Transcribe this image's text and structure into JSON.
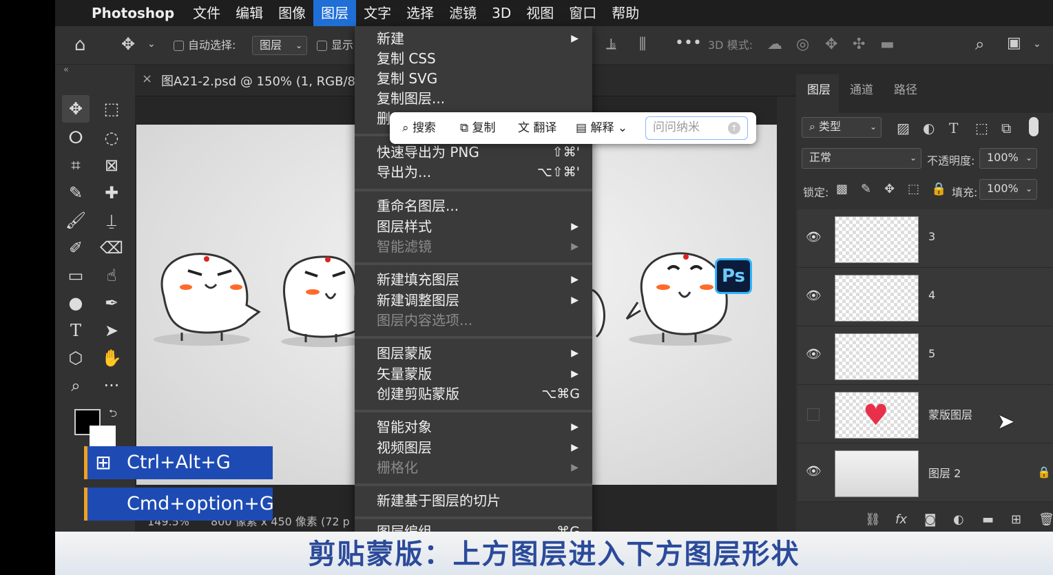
{
  "menubar": {
    "apple_icon": "apple-icon",
    "app": "Photoshop",
    "items": [
      "文件",
      "编辑",
      "图像",
      "图层",
      "文字",
      "选择",
      "滤镜",
      "3D",
      "视图",
      "窗口",
      "帮助"
    ],
    "active": "图层"
  },
  "options": {
    "auto_select": "自动选择:",
    "auto_select_target": "图层",
    "show_partial": "显示",
    "mode_3d": "3D 模式:"
  },
  "document": {
    "collapse": "«",
    "close": "×",
    "tab_title": "图A21-2.psd @ 150% (1, RGB/8"
  },
  "status": {
    "zoom": "149.5%",
    "size": "800 像素 x 450 像素 (72 p"
  },
  "menu": {
    "items": [
      {
        "label": "新建",
        "submenu": true
      },
      {
        "label": "复制 CSS"
      },
      {
        "label": "复制 SVG"
      },
      {
        "label": "复制图层..."
      },
      {
        "label": "删"
      },
      {
        "label": "快速导出为 PNG",
        "shortcut": "⇧⌘'"
      },
      {
        "label": "导出为...",
        "shortcut": "⌥⇧⌘'"
      },
      {
        "label": "重命名图层..."
      },
      {
        "label": "图层样式",
        "submenu": true
      },
      {
        "label": "智能滤镜",
        "submenu": true,
        "disabled": true
      },
      {
        "label": "新建填充图层",
        "submenu": true
      },
      {
        "label": "新建调整图层",
        "submenu": true
      },
      {
        "label": "图层内容选项...",
        "disabled": true
      },
      {
        "label": "图层蒙版",
        "submenu": true
      },
      {
        "label": "矢量蒙版",
        "submenu": true
      },
      {
        "label": "创建剪贴蒙版",
        "shortcut": "⌥⌘G"
      },
      {
        "label": "智能对象",
        "submenu": true
      },
      {
        "label": "视频图层",
        "submenu": true
      },
      {
        "label": "栅格化",
        "submenu": true,
        "disabled": true
      },
      {
        "label": "新建基于图层的切片"
      },
      {
        "label": "图层编组",
        "shortcut": "⌘G"
      }
    ]
  },
  "popup": {
    "search": "搜索",
    "copy": "复制",
    "translate": "翻译",
    "explain": "解释",
    "input_placeholder": "问问纳米"
  },
  "panel": {
    "tabs": [
      "图层",
      "通道",
      "路径"
    ],
    "filter": "类型",
    "blend_mode": "正常",
    "opacity_label": "不透明度:",
    "opacity": "100%",
    "lock_label": "锁定:",
    "fill_label": "填充:",
    "fill": "100%",
    "layers": [
      {
        "name": "3",
        "visible": true
      },
      {
        "name": "4",
        "visible": true
      },
      {
        "name": "5",
        "visible": true
      },
      {
        "name": "蒙版图层",
        "visible": false
      },
      {
        "name": "图层 2",
        "visible": true,
        "locked": true
      }
    ]
  },
  "overlay": {
    "win_shortcut": "Ctrl+Alt+G",
    "mac_shortcut": "Cmd+option+G",
    "subtitle": "剪贴蒙版：上方图层进入下方图层形状"
  },
  "badge": "Ps",
  "colors": {
    "menu_highlight": "#1f6fd6",
    "shortcut_bg": "#1e4bb3",
    "subtitle_text": "#2b4a9a"
  }
}
